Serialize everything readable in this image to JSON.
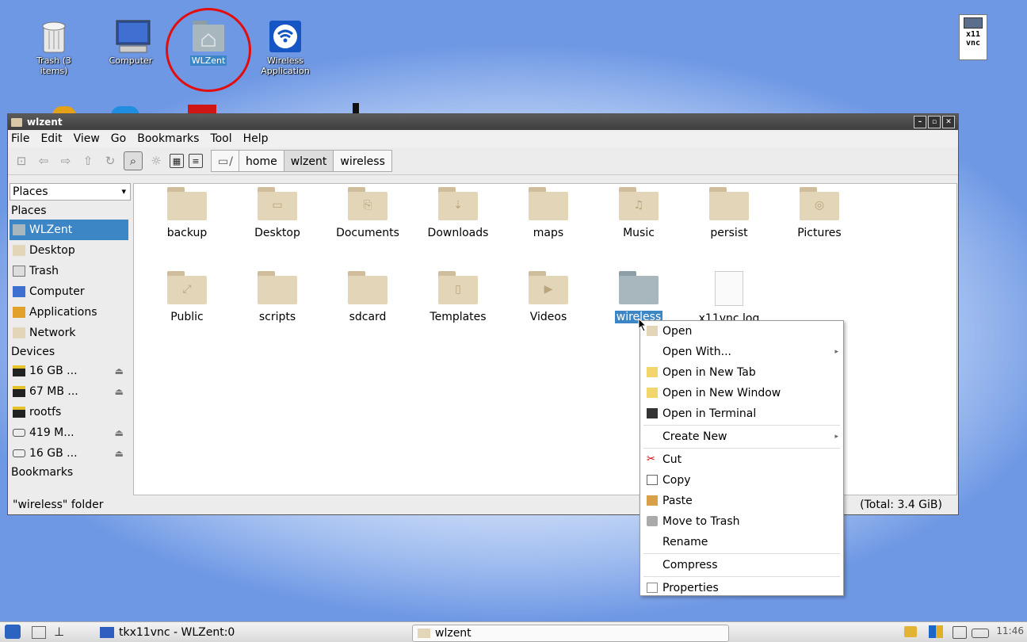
{
  "desktop": {
    "icons": [
      {
        "label": "Trash (3 items)",
        "icon": "trash-icon"
      },
      {
        "label": "Computer",
        "icon": "computer-icon"
      },
      {
        "label": "WLZent",
        "icon": "home-folder-icon"
      },
      {
        "label": "Wireless Application",
        "icon": "wireless-icon"
      }
    ],
    "x11vnc_label": "x11\nvnc",
    "highlight_color": "#e20d0d"
  },
  "window": {
    "title": "wlzent",
    "menu": [
      "File",
      "Edit",
      "View",
      "Go",
      "Bookmarks",
      "Tool",
      "Help"
    ],
    "path_root": "/",
    "breadcrumb": [
      "home",
      "wlzent",
      "wireless"
    ],
    "sidebar": {
      "combo": "Places",
      "places_header": "Places",
      "places": [
        "WLZent",
        "Desktop",
        "Trash",
        "Computer",
        "Applications",
        "Network"
      ],
      "devices_header": "Devices",
      "devices": [
        "16 GB ...",
        "67 MB ...",
        "rootfs",
        "419 M...",
        "16 GB ..."
      ],
      "bookmarks_header": "Bookmarks"
    },
    "files": [
      {
        "name": "backup",
        "glyph": ""
      },
      {
        "name": "Desktop",
        "glyph": "▭"
      },
      {
        "name": "Documents",
        "glyph": "⎘"
      },
      {
        "name": "Downloads",
        "glyph": "⇣"
      },
      {
        "name": "maps",
        "glyph": ""
      },
      {
        "name": "Music",
        "glyph": "♫"
      },
      {
        "name": "persist",
        "glyph": ""
      },
      {
        "name": "Pictures",
        "glyph": "◎"
      },
      {
        "name": "Public",
        "glyph": "⤢"
      },
      {
        "name": "scripts",
        "glyph": ""
      },
      {
        "name": "sdcard",
        "glyph": ""
      },
      {
        "name": "Templates",
        "glyph": "▯"
      },
      {
        "name": "Videos",
        "glyph": "▶"
      },
      {
        "name": "wireless",
        "glyph": ""
      },
      {
        "name": "x11vnc.log",
        "glyph": ""
      }
    ],
    "status_left": "\"wireless\" folder",
    "status_right": "(Total: 3.4 GiB)"
  },
  "context_menu": {
    "items": [
      "Open",
      "Open With...",
      "Open in New Tab",
      "Open in New Window",
      "Open in Terminal",
      "Create New",
      "Cut",
      "Copy",
      "Paste",
      "Move to Trash",
      "Rename",
      "Compress",
      "Properties"
    ]
  },
  "taskbar": {
    "task1": "tkx11vnc - WLZent:0",
    "task2": "wlzent",
    "clock": "11:46"
  }
}
